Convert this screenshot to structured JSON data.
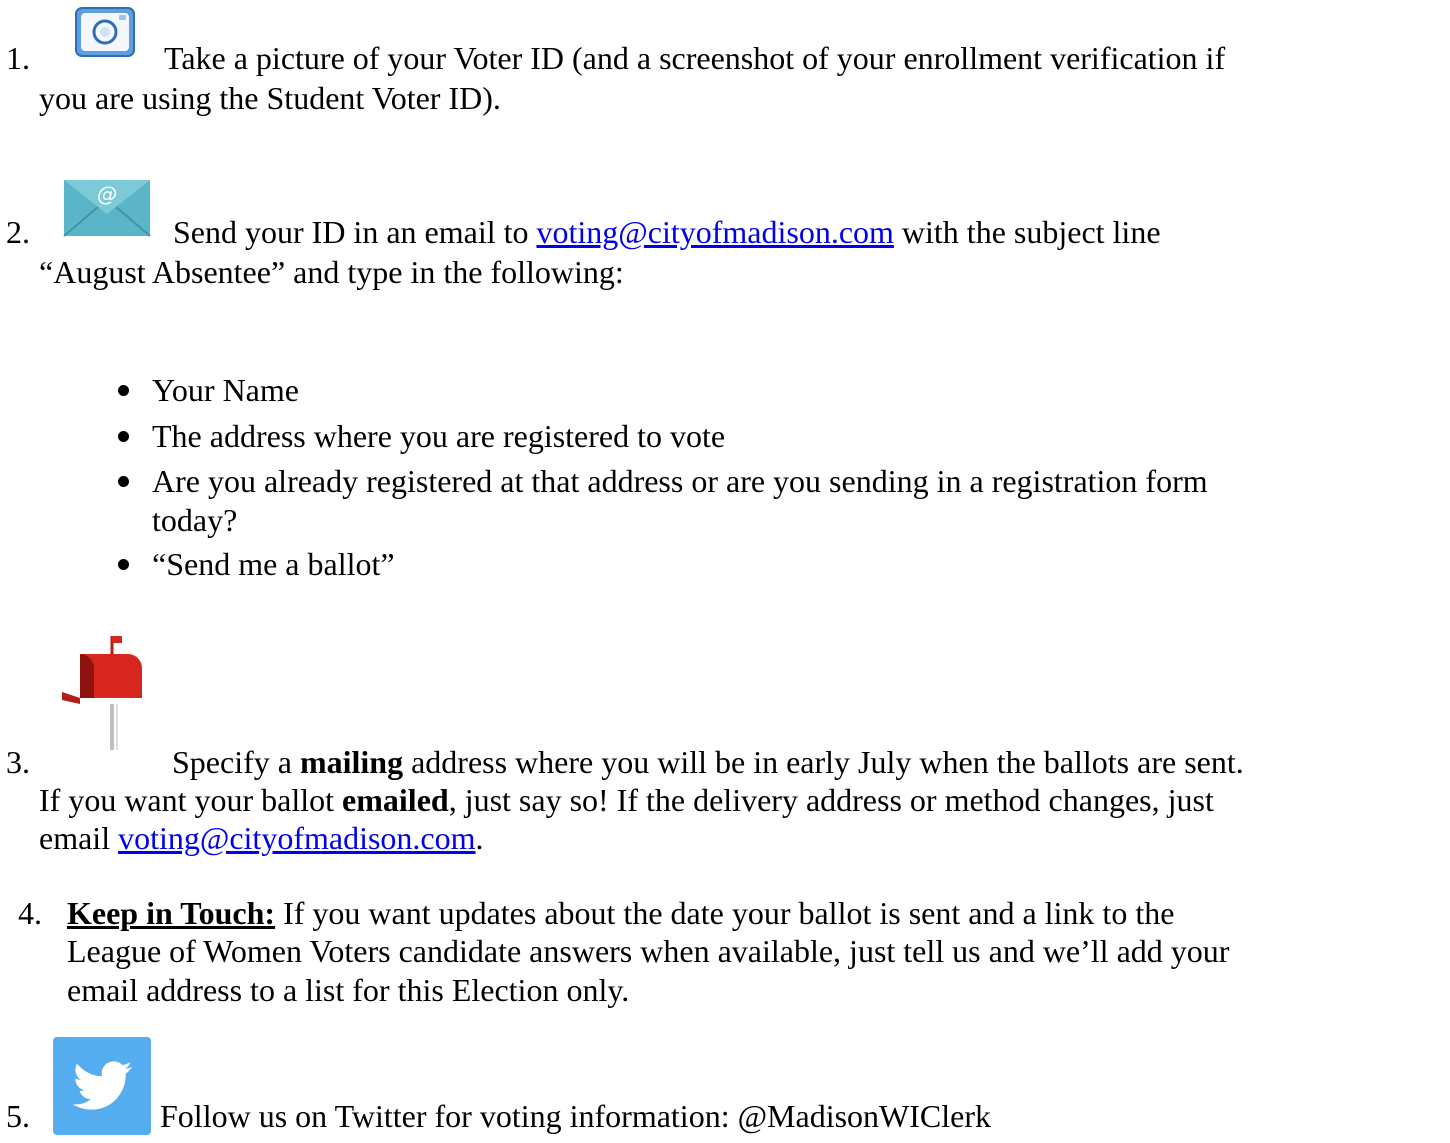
{
  "step1": {
    "number": "1.",
    "line1": "Take a picture of your Voter ID (and a screenshot of your enrollment verification if",
    "line2": "you are using the Student Voter ID).",
    "icon": "camera-icon"
  },
  "step2": {
    "number": "2.",
    "text_before": "Send your ID in an email to ",
    "email_link": "voting@cityofmadison.com",
    "text_after": " with the subject line",
    "line2": "“August Absentee” and type in the following:",
    "icon": "email-envelope-icon",
    "bullets": [
      "Your Name",
      "The address where you are registered to vote",
      "Are you already registered at that address or are you sending in a registration form",
      "today?",
      "“Send me a ballot”"
    ]
  },
  "step3": {
    "number": "3.",
    "l1_a": "Specify a ",
    "l1_bold": "mailing",
    "l1_b": " address where you will be in early July when the ballots are sent.",
    "l2_a": "If you want your ballot ",
    "l2_bold": "emailed",
    "l2_b": ", just say so! If the delivery address or method changes, just",
    "l3_a": "email ",
    "email_link": "voting@cityofmadison.com",
    "l3_b": ".",
    "icon": "mailbox-icon"
  },
  "step4": {
    "number": "4.",
    "heading": "Keep in Touch:",
    "l1_rest": " If you want updates about the date your ballot is sent and a link to the",
    "line2": "League of Women Voters candidate answers when available, just tell us and we’ll add your",
    "line3": "email address to a list for this Election only."
  },
  "step5": {
    "number": "5.",
    "text": "Follow us on Twitter for voting information: @MadisonWIClerk",
    "icon": "twitter-bird-icon"
  },
  "colors": {
    "link": "#0000ee",
    "camera_blue": "#4a90d9",
    "envelope_teal": "#5ab5c8",
    "mailbox_red": "#d7261e",
    "twitter_blue": "#55acee"
  }
}
